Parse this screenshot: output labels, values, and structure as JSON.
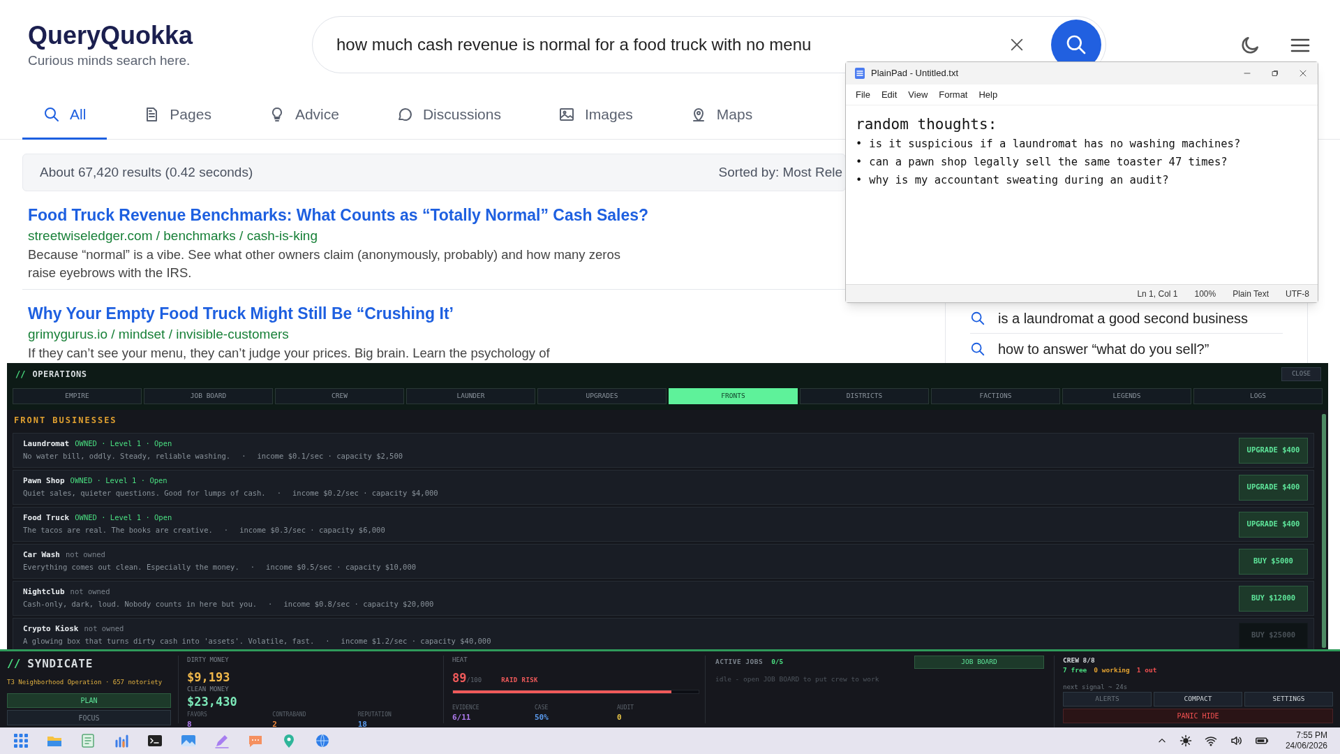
{
  "browser": {
    "logo": "QueryQuokka",
    "tagline": "Curious minds search here.",
    "query": "how much cash revenue is normal for a food truck with no menu",
    "tabs": [
      {
        "label": "All",
        "selected": true
      },
      {
        "label": "Pages",
        "selected": false
      },
      {
        "label": "Advice",
        "selected": false
      },
      {
        "label": "Discussions",
        "selected": false
      },
      {
        "label": "Images",
        "selected": false
      },
      {
        "label": "Maps",
        "selected": false
      }
    ],
    "results_info": "About 67,420 results (0.42 seconds)",
    "sort": "Sorted by: Most Rele",
    "results": [
      {
        "title": "Food Truck Revenue Benchmarks: What Counts as “Totally Normal” Cash Sales?",
        "url": "streetwiseledger.com / benchmarks / cash-is-king",
        "snippet": "Because “normal” is a vibe. See what other owners claim (anonymously, probably) and how many zeros raise eyebrows with the IRS."
      },
      {
        "title": "Why Your Empty Food Truck Might Still Be “Crushing It’",
        "url": "grimygurus.io / mindset / invisible-customers",
        "snippet": "If they can’t see your menu, they can’t judge your prices. Big brain. Learn the psychology of"
      }
    ],
    "related": [
      "is a laundromat a good second business",
      "how to answer “what do you sell?”"
    ]
  },
  "notepad": {
    "title": "PlainPad - Untitled.txt",
    "menu": [
      "File",
      "Edit",
      "View",
      "Format",
      "Help"
    ],
    "heading": "random thoughts:",
    "lines": [
      "is it suspicious if a laundromat has no washing machines?",
      "can a pawn shop legally sell the same toaster 47 times?",
      "why is my accountant sweating during an audit?"
    ],
    "bullet": "•",
    "status": [
      "Ln 1, Col 1",
      "100%",
      "Plain Text",
      "UTF-8"
    ]
  },
  "operations": {
    "prefix": "//",
    "title": "OPERATIONS",
    "close": "CLOSE",
    "tabs": [
      {
        "label": "EMPIRE",
        "selected": false
      },
      {
        "label": "JOB BOARD",
        "selected": false
      },
      {
        "label": "CREW",
        "selected": false
      },
      {
        "label": "LAUNDER",
        "selected": false
      },
      {
        "label": "UPGRADES",
        "selected": false
      },
      {
        "label": "FRONTS",
        "selected": true
      },
      {
        "label": "DISTRICTS",
        "selected": false
      },
      {
        "label": "FACTIONS",
        "selected": false
      },
      {
        "label": "LEGENDS",
        "selected": false
      },
      {
        "label": "LOGS",
        "selected": false
      }
    ],
    "section": "FRONT BUSINESSES",
    "separator": "·",
    "businesses": [
      {
        "name": "Laundromat",
        "owned": true,
        "status": "OWNED · Level 1 · Open",
        "description": "No water bill, oddly. Steady, reliable washing.",
        "stats": "income $0.1/sec · capacity $2,500",
        "button": "UPGRADE $400",
        "disabled": false
      },
      {
        "name": "Pawn Shop",
        "owned": true,
        "status": "OWNED · Level 1 · Open",
        "description": "Quiet sales, quieter questions. Good for lumps of cash.",
        "stats": "income $0.2/sec · capacity $4,000",
        "button": "UPGRADE $400",
        "disabled": false
      },
      {
        "name": "Food Truck",
        "owned": true,
        "status": "OWNED · Level 1 · Open",
        "description": "The tacos are real. The books are creative.",
        "stats": "income $0.3/sec · capacity $6,000",
        "button": "UPGRADE $400",
        "disabled": false
      },
      {
        "name": "Car Wash",
        "owned": false,
        "status": "not owned",
        "description": "Everything comes out clean. Especially the money.",
        "stats": "income $0.5/sec · capacity $10,000",
        "button": "BUY $5000",
        "disabled": false
      },
      {
        "name": "Nightclub",
        "owned": false,
        "status": "not owned",
        "description": "Cash-only, dark, loud. Nobody counts in here but you.",
        "stats": "income $0.8/sec · capacity $20,000",
        "button": "BUY $12000",
        "disabled": false
      },
      {
        "name": "Crypto Kiosk",
        "owned": false,
        "status": "not owned",
        "description": "A glowing box that turns dirty cash into 'assets'. Volatile, fast.",
        "stats": "income $1.2/sec · capacity $40,000",
        "button": "BUY $25000",
        "disabled": true
      }
    ]
  },
  "syndicate": {
    "prefix": "//",
    "title": "SYNDICATE",
    "subtitle": "T3 Neighborhood Operation · 657 notoriety",
    "modes": [
      {
        "label": "PLAN",
        "selected": true
      },
      {
        "label": "FOCUS",
        "selected": false
      }
    ],
    "dirty_label": "DIRTY MONEY",
    "dirty": "$9,193",
    "clean_label": "CLEAN MONEY",
    "clean": "$23,430",
    "stats": [
      {
        "label": "FAVORS",
        "value": "8",
        "color": "#b07cf0"
      },
      {
        "label": "CONTRABAND",
        "value": "2",
        "color": "#f0883e"
      },
      {
        "label": "REPUTATION",
        "value": "18",
        "color": "#5b9cf0"
      }
    ],
    "heat": {
      "label": "HEAT",
      "value": "89",
      "max": "/100",
      "warning": "RAID RISK",
      "level": 0.89
    },
    "heat_stats": [
      {
        "label": "EVIDENCE",
        "value": "6/11",
        "color": "#b07cf0"
      },
      {
        "label": "CASE",
        "value": "50%",
        "color": "#5b9cf0"
      },
      {
        "label": "AUDIT",
        "value": "0",
        "color": "#e8c547"
      }
    ],
    "jobs": {
      "label": "ACTIVE JOBS",
      "count": "0/5",
      "button": "JOB BOARD",
      "idle": "idle - open JOB BOARD to put crew to work"
    },
    "crew": {
      "label": "CREW 8/8",
      "parts": [
        {
          "text": "7 free",
          "color": "#4ade80"
        },
        {
          "text": "0 working",
          "color": "#e0a030"
        },
        {
          "text": "1 out",
          "color": "#f05050"
        }
      ],
      "signal": "next signal ~ 24s"
    },
    "buttons": [
      {
        "label": "ALERTS",
        "disabled": true
      },
      {
        "label": "COMPACT",
        "disabled": false
      },
      {
        "label": "SETTINGS",
        "disabled": false
      }
    ],
    "panic": "PANIC HIDE"
  },
  "taskbar": {
    "time": "7:55 PM",
    "date": "24/06/2026"
  }
}
